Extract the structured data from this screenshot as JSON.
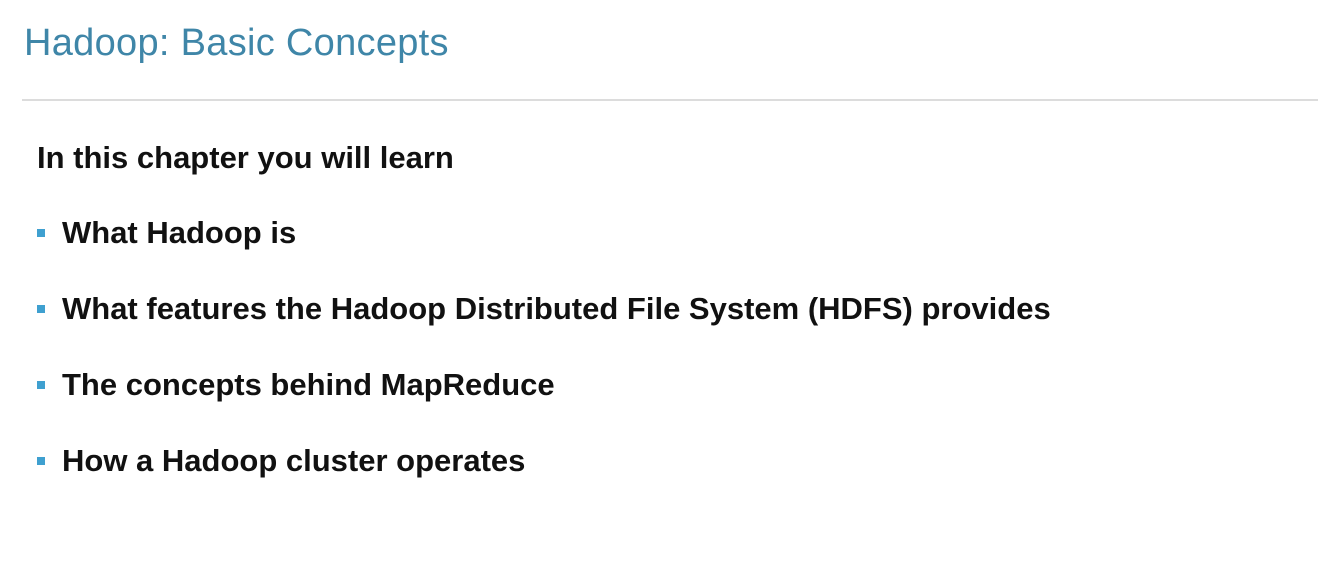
{
  "slide": {
    "title": "Hadoop: Basic Concepts",
    "intro": "In this chapter you will learn",
    "bullets": [
      "What Hadoop is",
      "What features the Hadoop Distributed File System (HDFS) provides",
      "The concepts behind MapReduce",
      "How a Hadoop cluster operates"
    ]
  },
  "colors": {
    "title": "#3f86a8",
    "bullet_marker": "#3fa0d0",
    "divider": "#dcdcdc",
    "text": "#111111"
  },
  "icons": {
    "bullet_marker": "square-bullet-icon"
  }
}
